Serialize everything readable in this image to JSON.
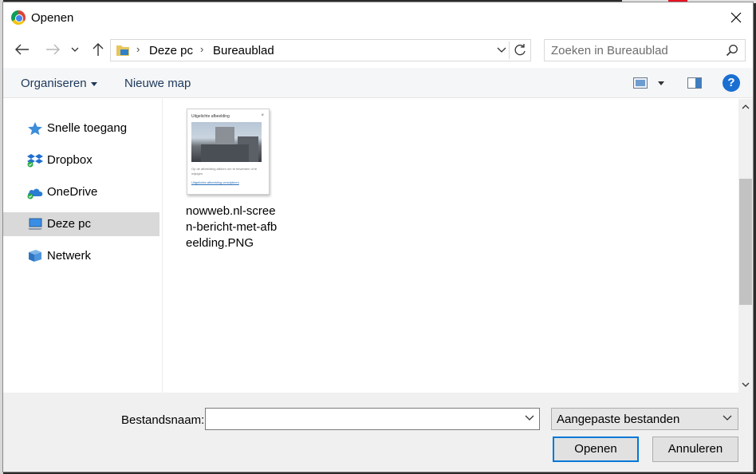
{
  "window": {
    "title": "Openen",
    "app_icon": "chrome-icon"
  },
  "address": {
    "breadcrumbs": [
      "Deze pc",
      "Bureaublad"
    ]
  },
  "search": {
    "placeholder": "Zoeken in Bureaublad"
  },
  "toolbar": {
    "organize_label": "Organiseren",
    "new_folder_label": "Nieuwe map",
    "help_label": "?"
  },
  "sidebar": {
    "items": [
      {
        "label": "Snelle toegang",
        "icon": "star-icon",
        "selected": false
      },
      {
        "label": "Dropbox",
        "icon": "dropbox-icon",
        "selected": false
      },
      {
        "label": "OneDrive",
        "icon": "onedrive-icon",
        "selected": false
      },
      {
        "label": "Deze pc",
        "icon": "computer-icon",
        "selected": true
      },
      {
        "label": "Netwerk",
        "icon": "network-icon",
        "selected": false
      }
    ]
  },
  "files": [
    {
      "name": "nowweb.nl-screen-bericht-met-afbeelding.PNG",
      "thumbnail": {
        "title": "Uitgelichte afbeelding",
        "close": "×",
        "caption": "Op de afbeelding klikken om te bewerken of te wijzigen",
        "link": "Uitgelichte afbeelding verwijderen"
      }
    }
  ],
  "bottom": {
    "filename_label": "Bestandsnaam:",
    "filename_value": "",
    "filetype_value": "Aangepaste bestanden",
    "open_label": "Openen",
    "cancel_label": "Annuleren"
  },
  "colors": {
    "accent": "#0078d7",
    "help_blue": "#1a6fd1",
    "selected_bg": "#d9d9d9",
    "command_text": "#1e395b"
  }
}
